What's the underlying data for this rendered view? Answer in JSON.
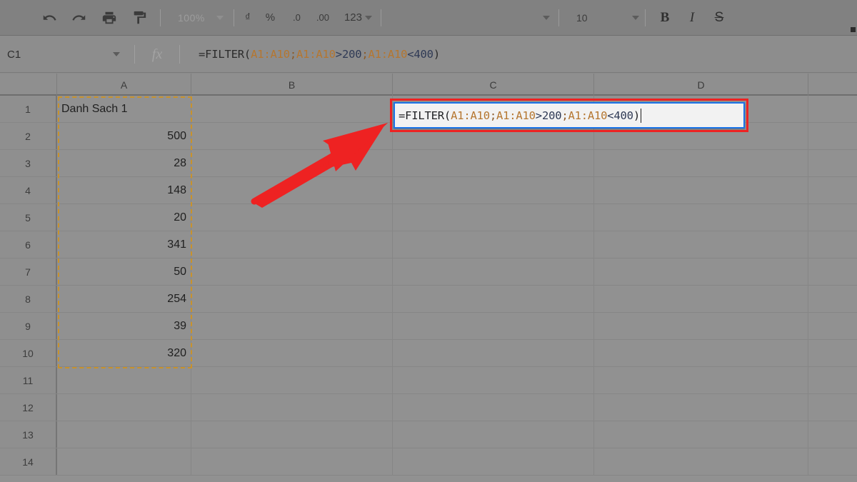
{
  "toolbar": {
    "undo_label": "undo-arrow",
    "redo_label": "redo-arrow",
    "print_label": "print",
    "paint_format_label": "paint-format",
    "zoom_value": "100%",
    "currency_label": "₫",
    "percent_label": "%",
    "decrease_decimal_label": ".0",
    "increase_decimal_label": ".00",
    "number_format_label": "123",
    "font_name_value": "",
    "font_size_value": "10",
    "bold_label": "B",
    "italic_label": "I",
    "strikethrough_label": "S"
  },
  "formula_bar": {
    "name_box_value": "C1",
    "fx_label": "fx",
    "formula_full": "=FILTER(A1:A10;A1:A10>200;A1:A10<400)",
    "tokens": [
      {
        "t": "=FILTER(",
        "k": "plain"
      },
      {
        "t": "A1:A10",
        "k": "ref"
      },
      {
        "t": ";",
        "k": "punct"
      },
      {
        "t": "A1:A10",
        "k": "ref"
      },
      {
        "t": ">",
        "k": "op"
      },
      {
        "t": "200",
        "k": "num"
      },
      {
        "t": ";",
        "k": "punct"
      },
      {
        "t": "A1:A10",
        "k": "ref"
      },
      {
        "t": "<",
        "k": "op"
      },
      {
        "t": "400",
        "k": "num"
      },
      {
        "t": ")",
        "k": "plain"
      }
    ]
  },
  "grid": {
    "column_headers": [
      "A",
      "B",
      "C",
      "D"
    ],
    "row_numbers": [
      "1",
      "2",
      "3",
      "4",
      "5",
      "6",
      "7",
      "8",
      "9",
      "10",
      "11",
      "12",
      "13",
      "14"
    ],
    "column_a_values": [
      "Danh Sach 1",
      "500",
      "28",
      "148",
      "20",
      "341",
      "50",
      "254",
      "39",
      "320",
      "",
      "",
      "",
      ""
    ],
    "column_a_alignments": [
      "txt",
      "num",
      "num",
      "num",
      "num",
      "num",
      "num",
      "num",
      "num",
      "num",
      "num",
      "num",
      "num",
      "num"
    ],
    "selection_range": "A1:A10"
  },
  "cell_editor": {
    "active_cell": "C1",
    "text": "=FILTER(A1:A10;A1:A10>200;A1:A10<400)"
  },
  "annotations": {
    "highlight_target": "C1 formula entry",
    "arrow_label": "red-pointer-arrow"
  },
  "colors": {
    "accent_blue": "#1a73e8",
    "annotation_red": "#ee2222",
    "marching_ants_orange": "#c8922c",
    "formula_ref_orange": "#b5762f",
    "toolbar_bg": "#818181",
    "grid_bg": "#919191"
  }
}
